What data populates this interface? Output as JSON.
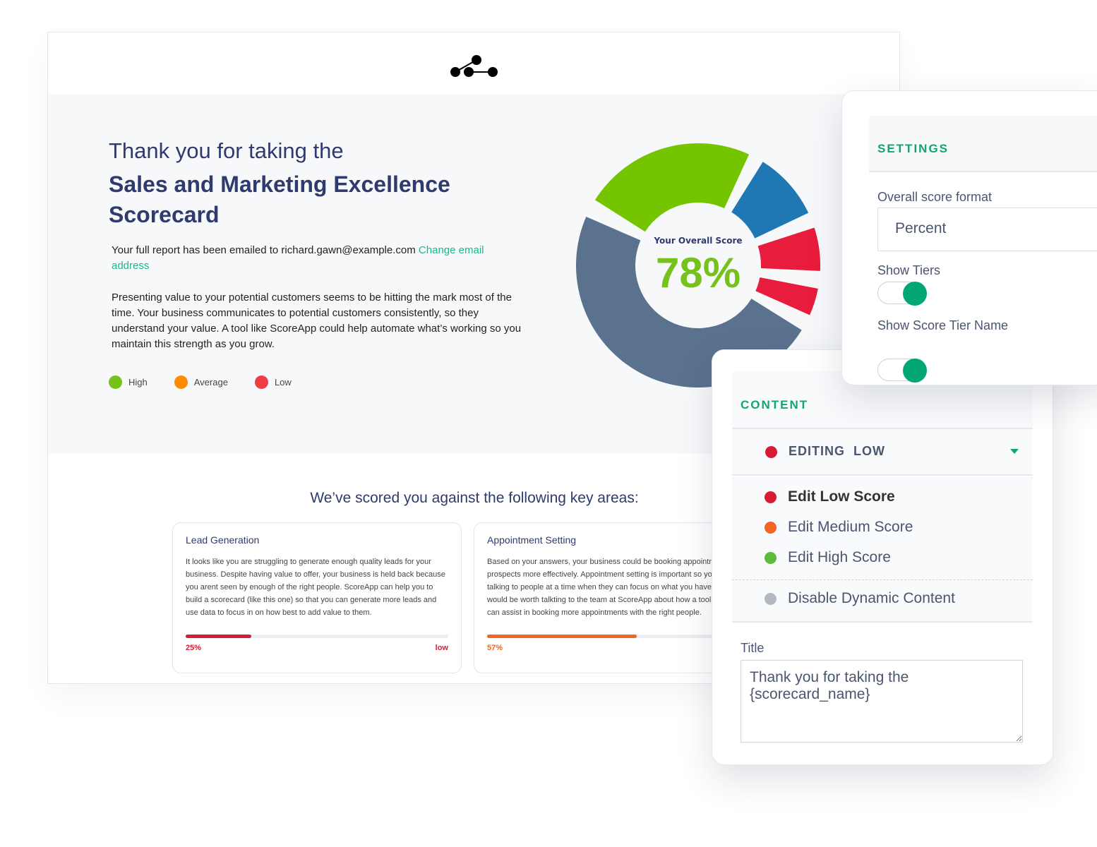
{
  "report": {
    "title_line1": "Thank you for taking the",
    "title_line2": "Sales and Marketing Excellence Scorecard",
    "email_text": "Your full report has been emailed to richard.gawn@example.com",
    "change_email_link": "Change email address",
    "summary": "Presenting value to your potential customers seems to be hitting the mark most of the time. Your business communicates to potential customers consistently, so they understand your value. A tool like ScoreApp could help automate what’s working so you maintain this strength as you grow.",
    "legend": [
      {
        "label": "High",
        "color": "#74c21a"
      },
      {
        "label": "Average",
        "color": "#ff8c00"
      },
      {
        "label": "Low",
        "color": "#ee3e45"
      }
    ],
    "score_label": "Your Overall Score",
    "score_value": "78%",
    "score_color": "#74c21a",
    "donut_segments": [
      {
        "color": "#74c400"
      },
      {
        "color": "#1f77b4"
      },
      {
        "color": "#e81c3c"
      },
      {
        "color": "#e81c3c"
      },
      {
        "color": "#5a728e"
      }
    ],
    "key_areas_heading": "We’ve scored you against the following key areas:",
    "cards": [
      {
        "title": "Lead Generation",
        "text": "It looks like you are struggling to generate enough quality leads for your business. Despite having value to offer, your business is held back because you arent seen by enough of the right people. ScoreApp can help you to build a scorecard (like this one) so that you can generate more leads and use data to focus in on how best to add value to them.",
        "percent": 25,
        "percent_label": "25%",
        "tier": "low",
        "color": "#d81b35"
      },
      {
        "title": "Appointment Setting",
        "text": "Based on your answers, your business could be booking appointments with prospects more effectively. Appointment setting is important so you are talking to people at a time when they can focus on what you have to say. It would be worth talkting to the team at ScoreApp about how a tool like this can assist in booking more appointments with the right people.",
        "percent": 57,
        "percent_label": "57%",
        "tier": "",
        "color": "#f26522"
      }
    ]
  },
  "settings": {
    "heading": "SETTINGS",
    "score_format_label": "Overall score format",
    "score_format_value": "Percent",
    "show_tiers_label": "Show Tiers",
    "show_tiers_on": true,
    "show_tier_name_label": "Show Score Tier Name",
    "show_tier_name_on": true
  },
  "content": {
    "heading": "CONTENT",
    "editing_label": "EDITING  LOW",
    "items": [
      {
        "label": "Edit Low Score",
        "color": "#d81b35",
        "active": true
      },
      {
        "label": "Edit Medium Score",
        "color": "#f26522"
      },
      {
        "label": "Edit High Score",
        "color": "#5dbb3c"
      }
    ],
    "disable_label": "Disable Dynamic Content",
    "disable_color": "#b3b8c2",
    "title_label": "Title",
    "title_value": "Thank you for taking the\n{scorecard_name}"
  }
}
